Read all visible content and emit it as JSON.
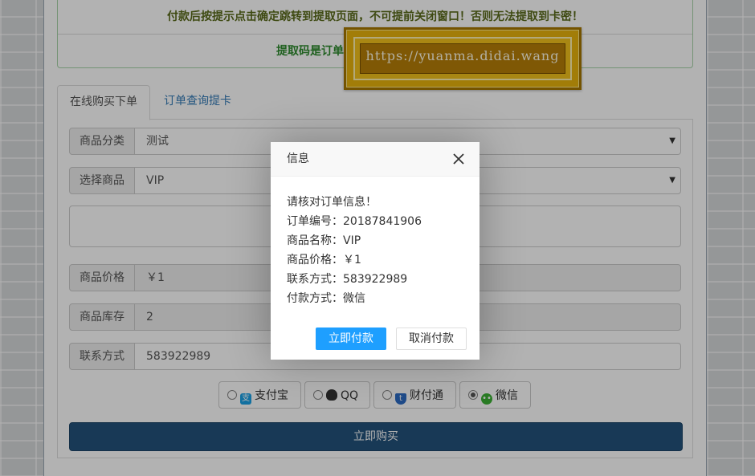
{
  "notice": {
    "line1": "付款后按提示点击确定跳转到提取页面，不可提前关闭窗口！否则无法提取到卡密！",
    "line2": "提取码是订单"
  },
  "banner": {
    "url": "https://yuanma.didai.wang"
  },
  "tabs": [
    {
      "label": "在线购买下单",
      "active": true
    },
    {
      "label": "订单查询提卡",
      "active": false
    }
  ],
  "form": {
    "category": {
      "label": "商品分类",
      "value": "测试"
    },
    "product": {
      "label": "选择商品",
      "value": "VIP"
    },
    "price": {
      "label": "商品价格",
      "value": "￥1"
    },
    "stock": {
      "label": "商品库存",
      "value": "2"
    },
    "contact": {
      "label": "联系方式",
      "value": "583922989"
    },
    "payment_methods": [
      {
        "label": "支付宝",
        "icon": "alipay-icon",
        "color": "#1aa1e6",
        "selected": false
      },
      {
        "label": "QQ",
        "icon": "qq-penguin-icon",
        "color": "#333333",
        "selected": false
      },
      {
        "label": "财付通",
        "icon": "tenpay-shield-icon",
        "color": "#2d6cc5",
        "selected": false
      },
      {
        "label": "微信",
        "icon": "wechat-icon",
        "color": "#3cb034",
        "selected": true
      }
    ],
    "buy_label": "立即购买"
  },
  "dialog": {
    "title": "信息",
    "lines": [
      "请核对订单信息！",
      "订单编号：20187841906",
      "商品名称：VIP",
      "商品价格：￥1",
      "联系方式：583922989",
      "付款方式：微信"
    ],
    "confirm_label": "立即付款",
    "cancel_label": "取消付款"
  },
  "colors": {
    "primary": "#1e9fff",
    "buy_button": "#23527c",
    "notice_green": "#2e8b2e"
  }
}
